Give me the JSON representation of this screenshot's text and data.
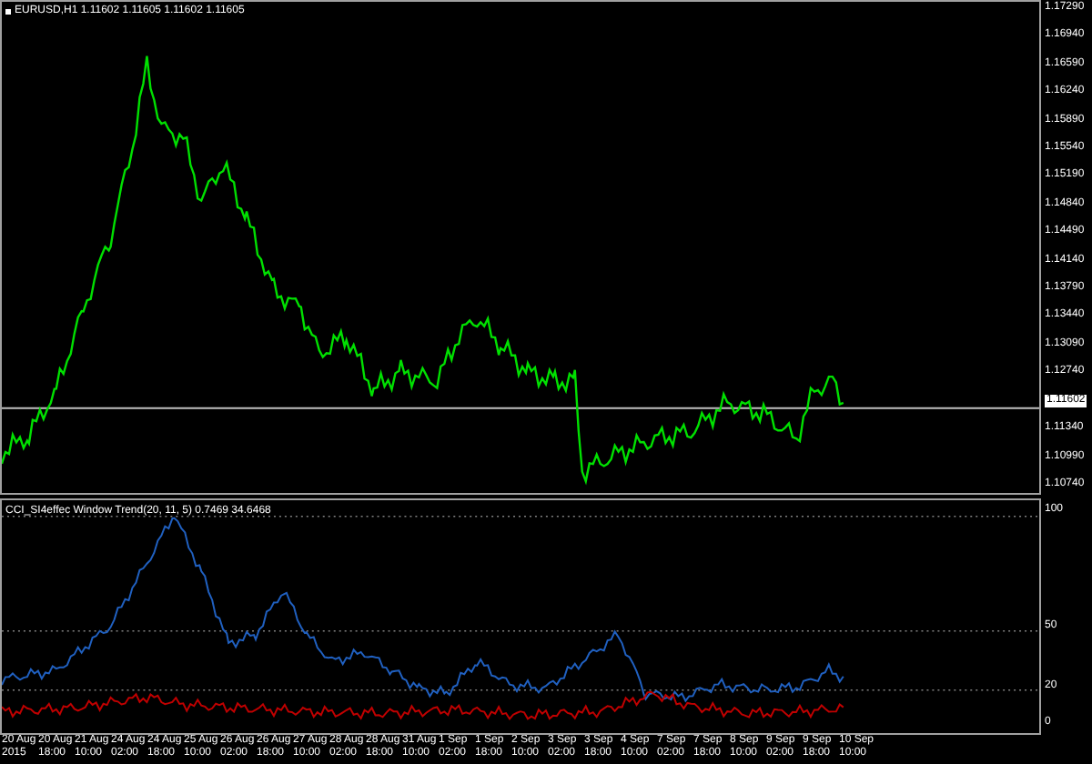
{
  "chart": {
    "title": "EURUSD,H1  1.11602 1.11605 1.11602 1.11605",
    "price_axis": [
      {
        "kind": "tick",
        "label": "1.17290"
      },
      {
        "kind": "tick",
        "label": "1.16940"
      },
      {
        "kind": "tick",
        "label": "1.16590"
      },
      {
        "kind": "tick",
        "label": "1.16240"
      },
      {
        "kind": "tick",
        "label": "1.15890"
      },
      {
        "kind": "tick",
        "label": "1.15540"
      },
      {
        "kind": "tick",
        "label": "1.15190"
      },
      {
        "kind": "tick",
        "label": "1.14840"
      },
      {
        "kind": "tick",
        "label": "1.14490"
      },
      {
        "kind": "tick",
        "label": "1.14140"
      },
      {
        "kind": "tick",
        "label": "1.13790"
      },
      {
        "kind": "tick",
        "label": "1.13440"
      },
      {
        "kind": "tick",
        "label": "1.13090"
      },
      {
        "kind": "tick",
        "label": "1.12740"
      },
      {
        "kind": "current",
        "label": "1.11602"
      },
      {
        "kind": "tick",
        "label": "1.11340"
      },
      {
        "kind": "tick",
        "label": "1.10990"
      },
      {
        "kind": "tick",
        "label": "1.10740"
      }
    ]
  },
  "indicator": {
    "title": "CCI_SI4effec Window Trend(20, 11, 5) 0.7469 34.6468",
    "axis": [
      "100",
      "50",
      "20",
      "0"
    ]
  },
  "time_axis": [
    "20 Aug 2015",
    "20 Aug 18:00",
    "21 Aug 10:00",
    "24 Aug 02:00",
    "24 Aug 18:00",
    "25 Aug 10:00",
    "26 Aug 02:00",
    "26 Aug 18:00",
    "27 Aug 10:00",
    "28 Aug 02:00",
    "28 Aug 18:00",
    "31 Aug 10:00",
    "1 Sep 02:00",
    "1 Sep 18:00",
    "2 Sep 10:00",
    "3 Sep 02:00",
    "3 Sep 18:00",
    "4 Sep 10:00",
    "7 Sep 02:00",
    "7 Sep 18:00",
    "8 Sep 10:00",
    "9 Sep 02:00",
    "9 Sep 18:00",
    "10 Sep 10:00"
  ]
}
